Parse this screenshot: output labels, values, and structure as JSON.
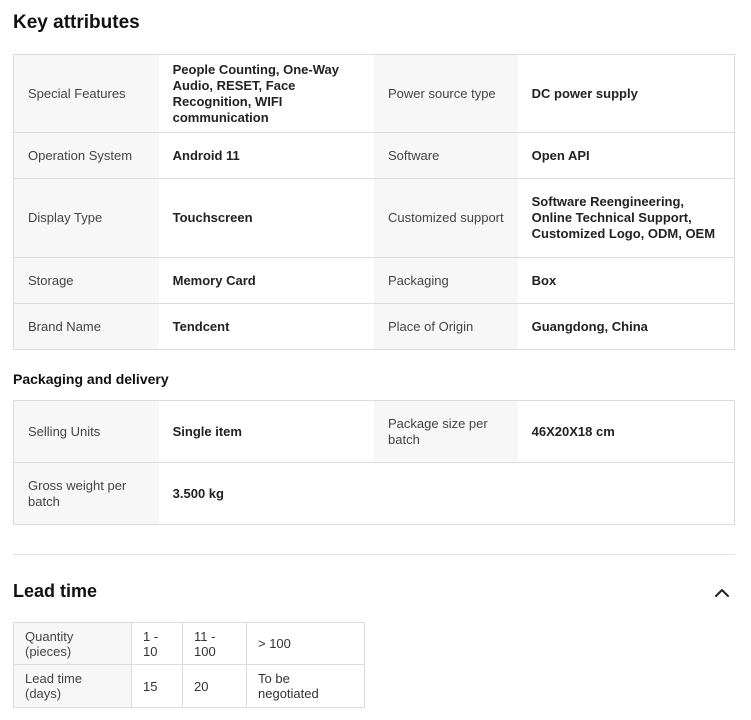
{
  "key_attributes": {
    "title": "Key attributes",
    "rows": [
      {
        "label1": "Special Features",
        "value1": "People Counting, One-Way Audio, RESET, Face Recognition, WIFI communication",
        "label2": "Power source type",
        "value2": "DC power supply"
      },
      {
        "label1": "Operation System",
        "value1": "Android 11",
        "label2": "Software",
        "value2": "Open API"
      },
      {
        "label1": "Display Type",
        "value1": "Touchscreen",
        "label2": "Customized support",
        "value2": "Software Reengineering, Online Technical Support, Customized Logo, ODM, OEM"
      },
      {
        "label1": "Storage",
        "value1": "Memory Card",
        "label2": "Packaging",
        "value2": "Box"
      },
      {
        "label1": "Brand Name",
        "value1": "Tendcent",
        "label2": "Place of Origin",
        "value2": "Guangdong, China"
      }
    ]
  },
  "packaging": {
    "title": "Packaging and delivery",
    "rows": [
      {
        "label1": "Selling Units",
        "value1": "Single item",
        "label2": "Package size per batch",
        "value2": "46X20X18 cm"
      },
      {
        "label1": "Gross weight per batch",
        "value1": "3.500 kg",
        "label2": "",
        "value2": ""
      }
    ]
  },
  "lead_time": {
    "title": "Lead time",
    "toggle_icon": "chevron-up-icon",
    "header": [
      "Quantity (pieces)",
      "1 - 10",
      "11 - 100",
      "> 100"
    ],
    "values": [
      "Lead time (days)",
      "15",
      "20",
      "To be negotiated"
    ]
  }
}
